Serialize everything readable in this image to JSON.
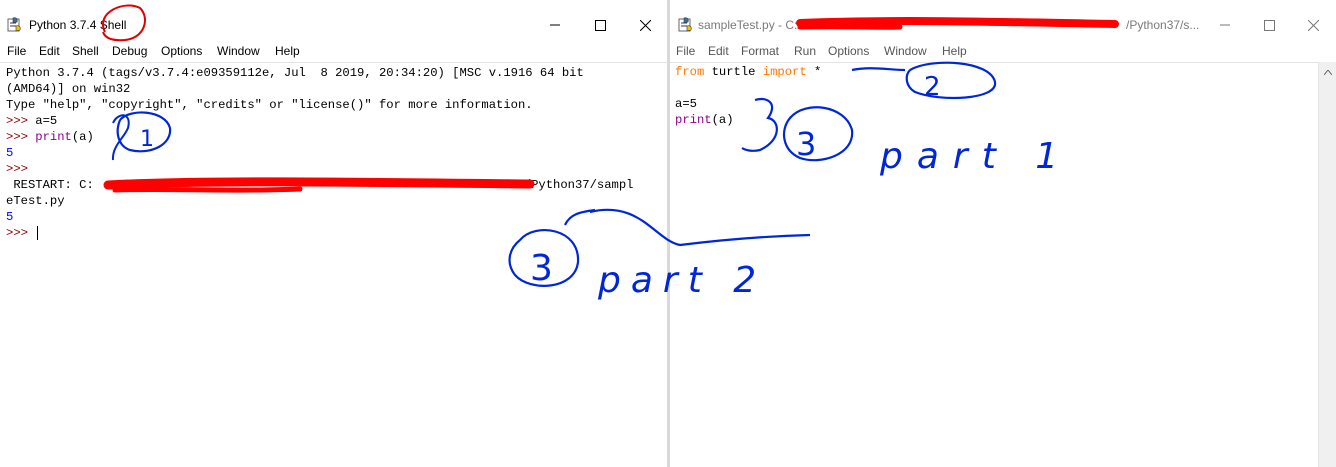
{
  "shell_window": {
    "title": "Python 3.7.4 Shell",
    "menu": [
      "File",
      "Edit",
      "Shell",
      "Debug",
      "Options",
      "Window",
      "Help"
    ],
    "controls": {
      "minimize": "—",
      "maximize": "☐",
      "close": "✕"
    },
    "banner_line1": "Python 3.7.4 (tags/v3.7.4:e09359112e, Jul  8 2019, 20:34:20) [MSC v.1916 64 bit",
    "banner_line2": "(AMD64)] on win32",
    "banner_line3": "Type \"help\", \"copyright\", \"credits\" or \"license()\" for more information.",
    "prompt": ">>> ",
    "cmd1": "a=5",
    "cmd2_func": "print",
    "cmd2_args": "(a)",
    "output1": "5",
    "prompt_bare": ">>>",
    "restart_prefix": " RESTART: C:",
    "restart_suffix": "/Python37/sampl",
    "restart_line2": "eTest.py",
    "output2": "5"
  },
  "editor_window": {
    "title": "sampleTest.py - C:/",
    "title_end": "/Python37/s...",
    "menu": [
      "File",
      "Edit",
      "Format",
      "Run",
      "Options",
      "Window",
      "Help"
    ],
    "controls": {
      "minimize": "—",
      "maximize": "☐",
      "close": "✕"
    },
    "code": {
      "kw_from": "from",
      "module": " turtle ",
      "kw_import": "import",
      "star": " *",
      "assign": "a=5",
      "print_func": "print",
      "print_args": "(a)"
    }
  },
  "annotations": {
    "mark_1": "1",
    "mark_2": "2",
    "mark_3a": "3",
    "mark_3b": "3",
    "part1": "part 1",
    "part2": "part 2"
  },
  "colors": {
    "prompt": "#8b0000",
    "keyword": "#ff7700",
    "builtin": "#900090",
    "output": "#0000ff",
    "annotation_ink": "#0026d9",
    "redaction": "#ff0000"
  }
}
